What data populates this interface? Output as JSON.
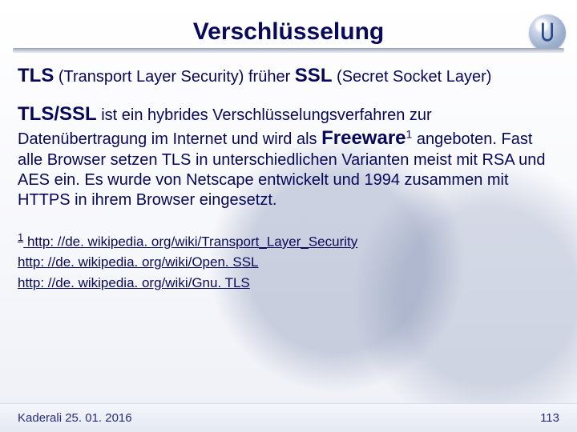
{
  "header": {
    "title": "Verschlüsselung",
    "logo_name": "university-logo"
  },
  "body": {
    "p1_strong_tls": "TLS",
    "p1_mid": " (Transport Layer Security) früher ",
    "p1_strong_ssl": "SSL",
    "p1_end": " (Secret Socket Layer)",
    "p2_strong": "TLS/SSL",
    "p2_a": " ist ein hybrides Verschlüsselungsverfahren zur Datenübertragung im Internet und wird als ",
    "p2_freeware": "Freeware",
    "p2_sup": "1",
    "p2_b": " angeboten. Fast alle Browser setzen TLS in unterschiedlichen Varianten meist mit RSA und AES ein. Es wurde von Netscape entwickelt und 1994 zusammen mit HTTPS in ihrem Browser eingesetzt."
  },
  "links": {
    "sup": "1",
    "l1": " http: //de. wikipedia. org/wiki/Transport_Layer_Security",
    "l2": "http: //de. wikipedia. org/wiki/Open. SSL",
    "l3": " http: //de. wikipedia. org/wiki/Gnu. TLS"
  },
  "footer": {
    "left": "Kaderali 25. 01. 2016",
    "right": "113"
  }
}
